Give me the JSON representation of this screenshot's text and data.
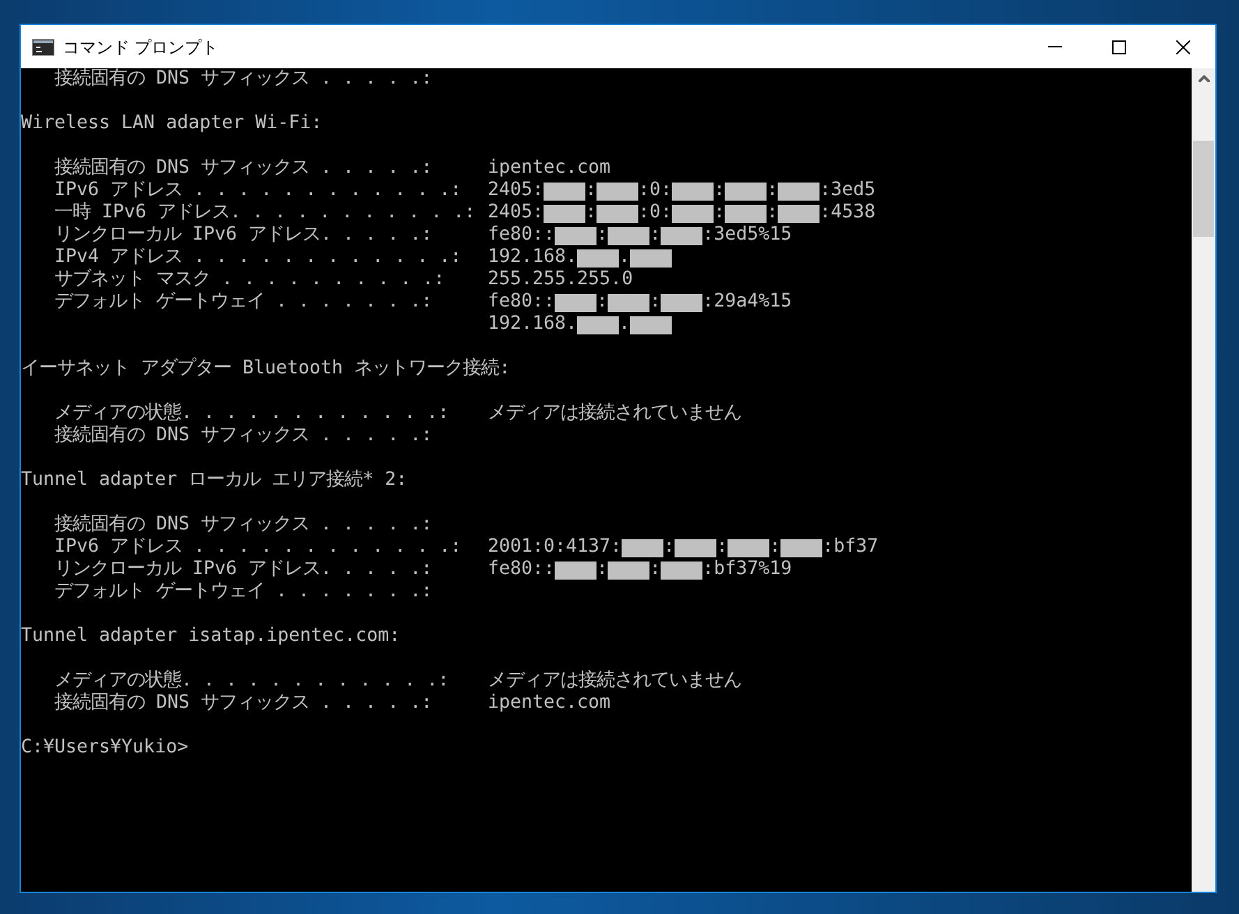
{
  "window": {
    "title": "コマンド プロンプト"
  },
  "console": {
    "sections": [
      {
        "fields": [
          {
            "label": "接続固有の DNS サフィックス . . . . .:"
          }
        ]
      },
      {
        "title": "Wireless LAN adapter Wi-Fi:",
        "fields": [
          {
            "label": "接続固有の DNS サフィックス . . . . .:",
            "value": [
              {
                "kind": "text",
                "text": "ipentec.com"
              }
            ]
          },
          {
            "label": "IPv6 アドレス . . . . . . . . . . . .:",
            "value": [
              {
                "kind": "text",
                "text": "2405:"
              },
              {
                "kind": "mask"
              },
              {
                "kind": "text",
                "text": ":"
              },
              {
                "kind": "mask"
              },
              {
                "kind": "text",
                "text": ":0:"
              },
              {
                "kind": "mask"
              },
              {
                "kind": "text",
                "text": ":"
              },
              {
                "kind": "mask"
              },
              {
                "kind": "text",
                "text": ":"
              },
              {
                "kind": "mask"
              },
              {
                "kind": "text",
                "text": ":3ed5"
              }
            ]
          },
          {
            "label": "一時 IPv6 アドレス. . . . . . . . . . .:",
            "value": [
              {
                "kind": "text",
                "text": "2405:"
              },
              {
                "kind": "mask"
              },
              {
                "kind": "text",
                "text": ":"
              },
              {
                "kind": "mask"
              },
              {
                "kind": "text",
                "text": ":0:"
              },
              {
                "kind": "mask"
              },
              {
                "kind": "text",
                "text": ":"
              },
              {
                "kind": "mask"
              },
              {
                "kind": "text",
                "text": ":"
              },
              {
                "kind": "mask"
              },
              {
                "kind": "text",
                "text": ":4538"
              }
            ]
          },
          {
            "label": "リンクローカル IPv6 アドレス. . . . .:",
            "value": [
              {
                "kind": "text",
                "text": "fe80::"
              },
              {
                "kind": "mask"
              },
              {
                "kind": "text",
                "text": ":"
              },
              {
                "kind": "mask"
              },
              {
                "kind": "text",
                "text": ":"
              },
              {
                "kind": "mask"
              },
              {
                "kind": "text",
                "text": ":3ed5%15"
              }
            ]
          },
          {
            "label": "IPv4 アドレス . . . . . . . . . . . .:",
            "value": [
              {
                "kind": "text",
                "text": "192.168."
              },
              {
                "kind": "mask"
              },
              {
                "kind": "text",
                "text": "."
              },
              {
                "kind": "mask"
              }
            ]
          },
          {
            "label": "サブネット マスク . . . . . . . . . .:",
            "value": [
              {
                "kind": "text",
                "text": "255.255.255.0"
              }
            ]
          },
          {
            "label": "デフォルト ゲートウェイ . . . . . . .:",
            "value": [
              {
                "kind": "text",
                "text": "fe80::"
              },
              {
                "kind": "mask"
              },
              {
                "kind": "text",
                "text": ":"
              },
              {
                "kind": "mask"
              },
              {
                "kind": "text",
                "text": ":"
              },
              {
                "kind": "mask"
              },
              {
                "kind": "text",
                "text": ":29a4%15"
              }
            ]
          },
          {
            "value": [
              {
                "kind": "text",
                "text": "192.168."
              },
              {
                "kind": "mask"
              },
              {
                "kind": "text",
                "text": "."
              },
              {
                "kind": "mask"
              }
            ]
          }
        ]
      },
      {
        "title": "イーサネット アダプター Bluetooth ネットワーク接続:",
        "fields": [
          {
            "label": "メディアの状態. . . . . . . . . . . .:",
            "value": [
              {
                "kind": "text",
                "text": "メディアは接続されていません"
              }
            ]
          },
          {
            "label": "接続固有の DNS サフィックス . . . . .:"
          }
        ]
      },
      {
        "title": "Tunnel adapter ローカル エリア接続* 2:",
        "fields": [
          {
            "label": "接続固有の DNS サフィックス . . . . .:"
          },
          {
            "label": "IPv6 アドレス . . . . . . . . . . . .:",
            "value": [
              {
                "kind": "text",
                "text": "2001:0:4137:"
              },
              {
                "kind": "mask"
              },
              {
                "kind": "text",
                "text": ":"
              },
              {
                "kind": "mask"
              },
              {
                "kind": "text",
                "text": ":"
              },
              {
                "kind": "mask"
              },
              {
                "kind": "text",
                "text": ":"
              },
              {
                "kind": "mask"
              },
              {
                "kind": "text",
                "text": ":bf37"
              }
            ]
          },
          {
            "label": "リンクローカル IPv6 アドレス. . . . .:",
            "value": [
              {
                "kind": "text",
                "text": "fe80::"
              },
              {
                "kind": "mask"
              },
              {
                "kind": "text",
                "text": ":"
              },
              {
                "kind": "mask"
              },
              {
                "kind": "text",
                "text": ":"
              },
              {
                "kind": "mask"
              },
              {
                "kind": "text",
                "text": ":bf37%19"
              }
            ]
          },
          {
            "label": "デフォルト ゲートウェイ . . . . . . .:"
          }
        ]
      },
      {
        "title": "Tunnel adapter isatap.ipentec.com:",
        "fields": [
          {
            "label": "メディアの状態. . . . . . . . . . . .:",
            "value": [
              {
                "kind": "text",
                "text": "メディアは接続されていません"
              }
            ]
          },
          {
            "label": "接続固有の DNS サフィックス . . . . .:",
            "value": [
              {
                "kind": "text",
                "text": "ipentec.com"
              }
            ]
          }
        ]
      }
    ],
    "prompt": "C:¥Users¥Yukio>"
  }
}
